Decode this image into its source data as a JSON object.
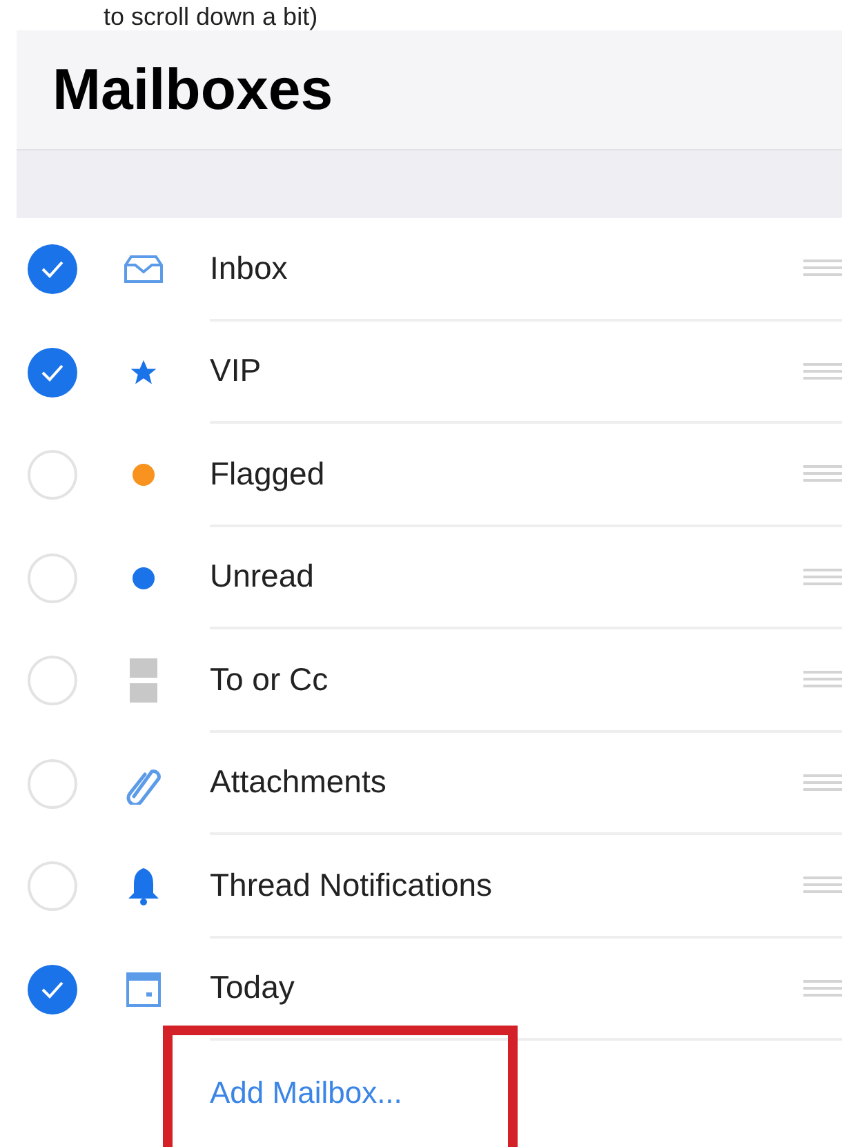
{
  "caption": "to scroll down a bit)",
  "title": "Mailboxes",
  "mailboxes": [
    {
      "label": "Inbox",
      "kind": "inbox",
      "checked": true
    },
    {
      "label": "VIP",
      "kind": "star",
      "checked": true
    },
    {
      "label": "Flagged",
      "kind": "dot",
      "color": "#f7931e",
      "checked": false
    },
    {
      "label": "Unread",
      "kind": "dot",
      "color": "#1a73e8",
      "checked": false
    },
    {
      "label": "To or Cc",
      "kind": "tocc",
      "checked": false
    },
    {
      "label": "Attachments",
      "kind": "paperclip",
      "checked": false
    },
    {
      "label": "Thread Notifications",
      "kind": "bell",
      "checked": false
    },
    {
      "label": "Today",
      "kind": "calendar",
      "checked": true
    }
  ],
  "add_mailbox": {
    "label": "Add Mailbox...",
    "highlighted": true
  }
}
